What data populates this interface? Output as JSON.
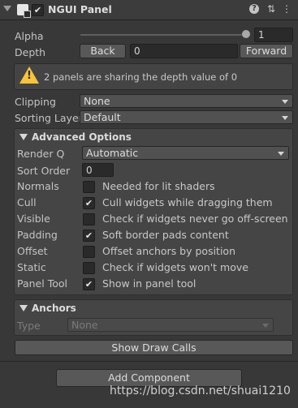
{
  "header": {
    "title": "NGUI Panel",
    "enabled_check": "✔",
    "help_glyph": "?",
    "preset_glyph": "⇅",
    "more_glyph": "⋮"
  },
  "alpha": {
    "label": "Alpha",
    "value": "1",
    "level": 1.0
  },
  "depth": {
    "label": "Depth",
    "back_label": "Back",
    "value": "0",
    "forward_label": "Forward"
  },
  "warning": {
    "icon_mark": "!",
    "text": "2 panels are sharing the depth value of 0"
  },
  "clipping": {
    "label": "Clipping",
    "value": "None"
  },
  "sorting_layer": {
    "label": "Sorting Layer",
    "value": "Default"
  },
  "advanced": {
    "title": "Advanced Options",
    "render_q": {
      "label": "Render Q",
      "value": "Automatic"
    },
    "sort_order": {
      "label": "Sort Order",
      "value": "0"
    },
    "options": [
      {
        "label": "Normals",
        "checked": false,
        "mark": "",
        "desc": "Needed for lit shaders"
      },
      {
        "label": "Cull",
        "checked": true,
        "mark": "✔",
        "desc": "Cull widgets while dragging them"
      },
      {
        "label": "Visible",
        "checked": false,
        "mark": "",
        "desc": "Check if widgets never go off-screen"
      },
      {
        "label": "Padding",
        "checked": true,
        "mark": "✔",
        "desc": "Soft border pads content"
      },
      {
        "label": "Offset",
        "checked": false,
        "mark": "",
        "desc": "Offset anchors by position"
      },
      {
        "label": "Static",
        "checked": false,
        "mark": "",
        "desc": "Check if widgets won't move"
      },
      {
        "label": "Panel Tool",
        "checked": true,
        "mark": "✔",
        "desc": "Show in panel tool"
      }
    ]
  },
  "anchors": {
    "title": "Anchors",
    "type_label": "Type",
    "type_value": "None"
  },
  "show_draw_calls_label": "Show Draw Calls",
  "add_component_label": "Add Component",
  "watermark": "https://blog.csdn.net/shuai1210",
  "colors": {
    "background": "#383838",
    "panel": "#454545",
    "warning": "#f7c43a",
    "field": "#2a2a2a"
  }
}
